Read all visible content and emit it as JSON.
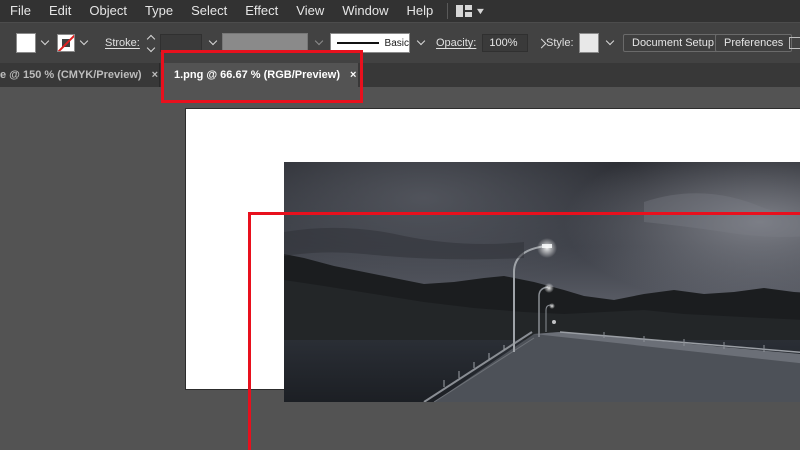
{
  "menu": {
    "items": [
      "File",
      "Edit",
      "Object",
      "Type",
      "Select",
      "Effect",
      "View",
      "Window",
      "Help"
    ],
    "workspace_icon": "workspace-grid-icon"
  },
  "control_bar": {
    "fill_color": "#ffffff",
    "stroke_label": "Stroke:",
    "brush_label": "Basic",
    "opacity_label": "Opacity:",
    "opacity_value": "100%",
    "style_label": "Style:",
    "document_setup_label": "Document Setup",
    "preferences_label": "Preferences"
  },
  "tabs": [
    {
      "label": "e @ 150 % (CMYK/Preview)",
      "close": "×",
      "active": false
    },
    {
      "label": "1.png @ 66.67 % (RGB/Preview)",
      "close": "×",
      "active": true
    }
  ],
  "canvas": {
    "artboard_color": "#ffffff",
    "image_subject": "dark stormy sky over a bridge with street lamps and hills"
  },
  "annotations": {
    "highlight_color": "#e8101d"
  }
}
